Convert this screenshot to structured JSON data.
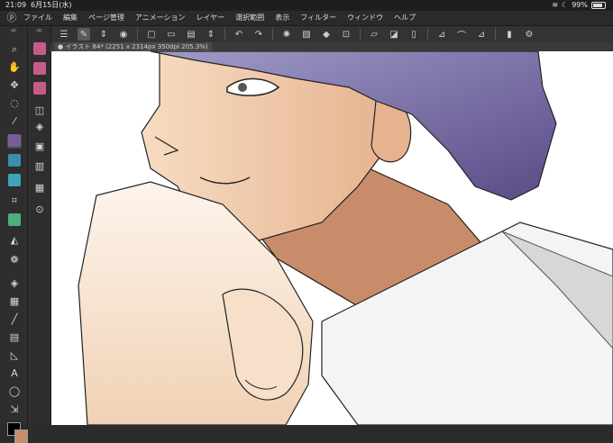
{
  "status": {
    "time": "21:09",
    "date": "6月15日(水)",
    "battery": "99%"
  },
  "menu": {
    "items": [
      "ファイル",
      "編集",
      "ページ管理",
      "アニメーション",
      "レイヤー",
      "選択範囲",
      "表示",
      "フィルター",
      "ウィンドウ",
      "ヘルプ"
    ]
  },
  "tab": {
    "title": "● イラスト 84* (2251 x 2314px 350dpi 205.3%)"
  },
  "colors": {
    "main": "#000000",
    "sub": "#c98c6a",
    "hair": "#6b5a8c",
    "skin": "#f4d3b3",
    "shadow": "#c98c6a"
  },
  "icons": {
    "app_logo": "clip-studio-logo-icon",
    "wifi": "wifi-icon",
    "moon": "moon-icon",
    "battery": "battery-icon"
  }
}
